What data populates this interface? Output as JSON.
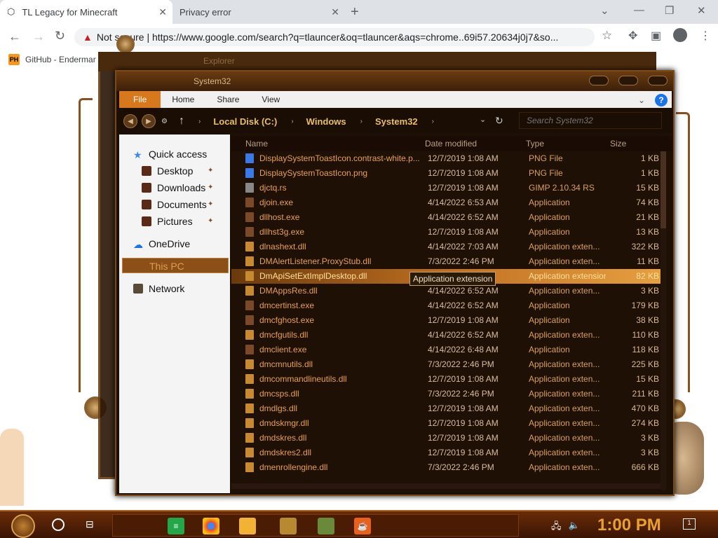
{
  "browser": {
    "tabs": [
      {
        "title": "TL Legacy for Minecraft"
      },
      {
        "title": "Privacy error"
      }
    ],
    "address": "Not secure | https://www.google.com/search?q=tlauncer&oq=tlauncer&aqs=chrome..69i57.20634j0j7&so...",
    "address_warning": "Not secure",
    "bookmark": "GitHub - Endermar",
    "bookmark_icon": "PH"
  },
  "explorer": {
    "title": "System32",
    "ghost_title": "Explorer",
    "ribbon": [
      "File",
      "Home",
      "Share",
      "View"
    ],
    "breadcrumb": [
      "Local Disk (C:)",
      "Windows",
      "System32"
    ],
    "search_placeholder": "Search System32",
    "nav": {
      "quick_access": "Quick access",
      "desktop": "Desktop",
      "downloads": "Downloads",
      "documents": "Documents",
      "pictures": "Pictures",
      "onedrive": "OneDrive",
      "this_pc": "This PC",
      "network": "Network"
    },
    "columns": {
      "name": "Name",
      "date": "Date modified",
      "type": "Type",
      "size": "Size"
    },
    "files": [
      {
        "name": "DisplaySystemToastIcon.contrast-white.p...",
        "date": "12/7/2019 1:08 AM",
        "type": "PNG File",
        "size": "1 KB",
        "icon": "png"
      },
      {
        "name": "DisplaySystemToastIcon.png",
        "date": "12/7/2019 1:08 AM",
        "type": "PNG File",
        "size": "1 KB",
        "icon": "png"
      },
      {
        "name": "djctq.rs",
        "date": "12/7/2019 1:08 AM",
        "type": "GIMP 2.10.34 RS",
        "size": "15 KB",
        "icon": "gimp"
      },
      {
        "name": "djoin.exe",
        "date": "4/14/2022 6:53 AM",
        "type": "Application",
        "size": "74 KB",
        "icon": "exe"
      },
      {
        "name": "dllhost.exe",
        "date": "4/14/2022 6:52 AM",
        "type": "Application",
        "size": "21 KB",
        "icon": "exe"
      },
      {
        "name": "dllhst3g.exe",
        "date": "12/7/2019 1:08 AM",
        "type": "Application",
        "size": "13 KB",
        "icon": "exe"
      },
      {
        "name": "dlnashext.dll",
        "date": "4/14/2022 7:03 AM",
        "type": "Application exten...",
        "size": "322 KB",
        "icon": "dll"
      },
      {
        "name": "DMAlertListener.ProxyStub.dll",
        "date": "7/3/2022 2:46 PM",
        "type": "Application exten...",
        "size": "11 KB",
        "icon": "dll"
      },
      {
        "name": "DmApiSetExtImplDesktop.dll",
        "date": "7/3/2022 2:46 PM",
        "type": "Application extension",
        "size": "82 KB",
        "icon": "dll",
        "selected": true
      },
      {
        "name": "DMAppsRes.dll",
        "date": "4/14/2022 6:52 AM",
        "type": "Application exten...",
        "size": "3 KB",
        "icon": "dll"
      },
      {
        "name": "dmcertinst.exe",
        "date": "4/14/2022 6:52 AM",
        "type": "Application",
        "size": "179 KB",
        "icon": "exe"
      },
      {
        "name": "dmcfghost.exe",
        "date": "12/7/2019 1:08 AM",
        "type": "Application",
        "size": "38 KB",
        "icon": "exe"
      },
      {
        "name": "dmcfgutils.dll",
        "date": "4/14/2022 6:52 AM",
        "type": "Application exten...",
        "size": "110 KB",
        "icon": "dll"
      },
      {
        "name": "dmclient.exe",
        "date": "4/14/2022 6:48 AM",
        "type": "Application",
        "size": "118 KB",
        "icon": "exe"
      },
      {
        "name": "dmcmnutils.dll",
        "date": "7/3/2022 2:46 PM",
        "type": "Application exten...",
        "size": "225 KB",
        "icon": "dll"
      },
      {
        "name": "dmcommandlineutils.dll",
        "date": "12/7/2019 1:08 AM",
        "type": "Application exten...",
        "size": "15 KB",
        "icon": "dll"
      },
      {
        "name": "dmcsps.dll",
        "date": "7/3/2022 2:46 PM",
        "type": "Application exten...",
        "size": "211 KB",
        "icon": "dll"
      },
      {
        "name": "dmdlgs.dll",
        "date": "12/7/2019 1:08 AM",
        "type": "Application exten...",
        "size": "470 KB",
        "icon": "dll"
      },
      {
        "name": "dmdskmgr.dll",
        "date": "12/7/2019 1:08 AM",
        "type": "Application exten...",
        "size": "274 KB",
        "icon": "dll"
      },
      {
        "name": "dmdskres.dll",
        "date": "12/7/2019 1:08 AM",
        "type": "Application exten...",
        "size": "3 KB",
        "icon": "dll"
      },
      {
        "name": "dmdskres2.dll",
        "date": "12/7/2019 1:08 AM",
        "type": "Application exten...",
        "size": "3 KB",
        "icon": "dll"
      },
      {
        "name": "dmenrollengine.dll",
        "date": "7/3/2022 2:46 PM",
        "type": "Application exten...",
        "size": "666 KB",
        "icon": "dll"
      }
    ]
  },
  "taskbar": {
    "clock": "1:00 PM",
    "notif_count": "1"
  },
  "colors": {
    "accent": "#d8781c",
    "theme_dark": "#1c0f05",
    "text_orange": "#e8a050"
  }
}
